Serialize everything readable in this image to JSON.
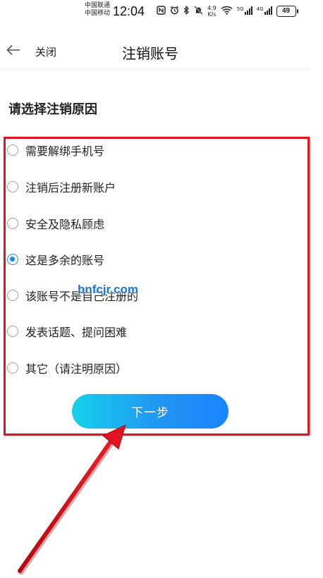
{
  "status_bar": {
    "carrier_1": "中国联通",
    "carrier_2": "中国移动",
    "time": "12:04",
    "net_speed_value": "4.9",
    "net_speed_unit": "K/s",
    "signal_1_tag": "5G",
    "signal_2_tag": "4G",
    "battery": "49"
  },
  "header": {
    "close_label": "关闭",
    "title": "注销账号"
  },
  "section_title": "请选择注销原因",
  "reasons": [
    {
      "label": "需要解绑手机号",
      "checked": false
    },
    {
      "label": "注销后注册新账户",
      "checked": false
    },
    {
      "label": "安全及隐私顾虑",
      "checked": false
    },
    {
      "label": "这是多余的账号",
      "checked": true
    },
    {
      "label": "该账号不是自己注册的",
      "checked": false
    },
    {
      "label": "发表话题、提问困难",
      "checked": false
    },
    {
      "label": "其它（请注明原因）",
      "checked": false
    }
  ],
  "next_button_label": "下一步",
  "watermark": "bnfcjr.com",
  "colors": {
    "accent_blue": "#1e88f5",
    "gradient_start": "#14d2ea",
    "gradient_end": "#1a83ff",
    "annotation_red": "#e0141e"
  }
}
